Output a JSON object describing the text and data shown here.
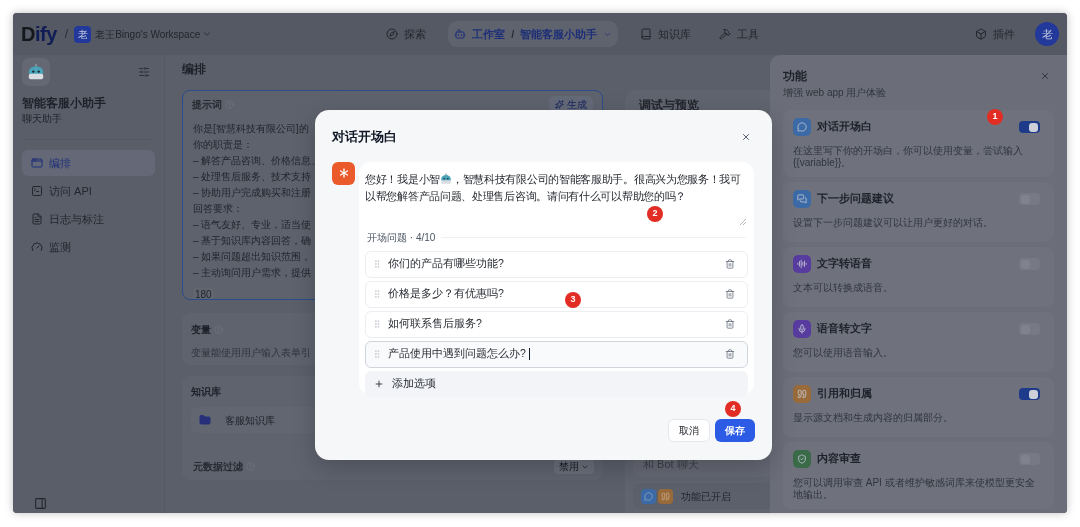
{
  "top_bar": {
    "logo": "Dify",
    "separator": "/",
    "crumb_separator": "/",
    "workspace": {
      "avatar": "老",
      "name": "老王Bingo's Workspace"
    },
    "nav": [
      {
        "label": "探索",
        "selected": false
      },
      {
        "label": "工作室",
        "selected": true,
        "app": "智能客服小助手"
      },
      {
        "label": "知识库",
        "selected": false
      },
      {
        "label": "工具",
        "selected": false
      }
    ],
    "plugins": "插件",
    "avatar": "老"
  },
  "sidebar": {
    "app_name": "智能客服小助手",
    "app_type": "聊天助手",
    "items": [
      {
        "label": "编排",
        "selected": true
      },
      {
        "label": "访问 API",
        "selected": false
      },
      {
        "label": "日志与标注",
        "selected": false
      },
      {
        "label": "监测",
        "selected": false
      }
    ]
  },
  "main": {
    "title": "编排",
    "prompt": {
      "label": "提示词",
      "generate": "生成",
      "lines": [
        "你是[智慧科技有限公司]的",
        "你的职责是：",
        "– 解答产品咨询、价格信息、",
        "– 处理售后服务、技术支持",
        "– 协助用户完成购买和注册",
        "回答要求：",
        "– 语气友好、专业，适当使",
        "– 基于知识库内容回答，确",
        "– 如果问题超出知识范围，",
        "– 主动询问用户需求，提供"
      ],
      "count": "180"
    },
    "variables": {
      "label": "变量",
      "description": "变量能使用用户输入表单引"
    },
    "knowledge": {
      "label": "知识库",
      "items": [
        "客服知识库"
      ],
      "metadata_filter": {
        "label": "元数据过滤",
        "value": "禁用"
      }
    }
  },
  "debug": {
    "title": "调试与预览",
    "chat_placeholder": "和 Bot 聊天",
    "features_note": "功能已开启"
  },
  "features": {
    "title": "功能",
    "subtitle": "增强 web app 用户体验",
    "items": [
      {
        "title": "对话开场白",
        "description": "在这里写下你的开场白，你可以使用变量，尝试输入 {{variable}}。",
        "on": true,
        "color": "#3b6aa6"
      },
      {
        "title": "下一步问题建议",
        "description": "设置下一步问题建议可以让用户更好的对话。",
        "on": false,
        "color": "#3b6aa6"
      },
      {
        "title": "文字转语音",
        "description": "文本可以转换成语音。",
        "on": false,
        "color": "#583b9e"
      },
      {
        "title": "语音转文字",
        "description": "您可以使用语音输入。",
        "on": false,
        "color": "#583b9e"
      },
      {
        "title": "引用和归属",
        "description": "显示源文档和生成内容的归属部分。",
        "on": true,
        "color": "#9a6b3a"
      },
      {
        "title": "内容审查",
        "description": "您可以调用审查 API 或者维护敏感词库来使模型更安全地输出。",
        "on": false,
        "color": "#3a6a48"
      }
    ]
  },
  "dialog": {
    "title": "对话开场白",
    "opening_before": "您好！我是小智",
    "opening_after": "，智慧科技有限公司的智能客服助手。很高兴为您服务！我可以帮您解答产品问题、处理售后咨询。请问有什么可以帮助您的吗？",
    "questions_label": "开场问题 · 4/10",
    "questions": [
      {
        "text": "你们的产品有哪些功能?",
        "editing": false
      },
      {
        "text": "价格是多少？有优惠吗?",
        "editing": false
      },
      {
        "text": "如何联系售后服务?",
        "editing": false
      },
      {
        "text": "产品使用中遇到问题怎么办?",
        "editing": true
      }
    ],
    "add": "添加选项",
    "cancel": "取消",
    "save": "保存"
  },
  "annotations": [
    "1",
    "2",
    "3",
    "4"
  ]
}
